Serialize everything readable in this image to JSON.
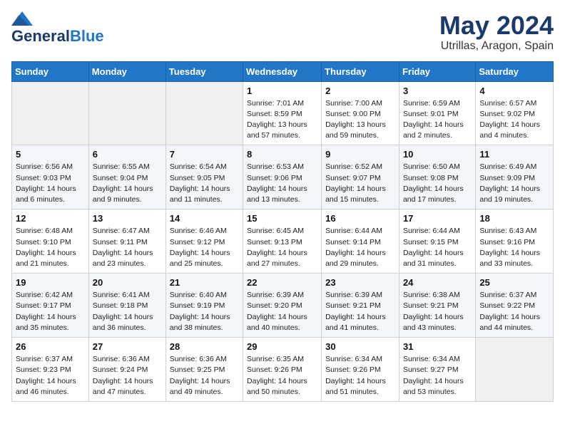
{
  "header": {
    "logo_general": "General",
    "logo_blue": "Blue",
    "month": "May 2024",
    "location": "Utrillas, Aragon, Spain"
  },
  "days_of_week": [
    "Sunday",
    "Monday",
    "Tuesday",
    "Wednesday",
    "Thursday",
    "Friday",
    "Saturday"
  ],
  "weeks": [
    [
      {
        "day": "",
        "sunrise": "",
        "sunset": "",
        "daylight": ""
      },
      {
        "day": "",
        "sunrise": "",
        "sunset": "",
        "daylight": ""
      },
      {
        "day": "",
        "sunrise": "",
        "sunset": "",
        "daylight": ""
      },
      {
        "day": "1",
        "sunrise": "Sunrise: 7:01 AM",
        "sunset": "Sunset: 8:59 PM",
        "daylight": "Daylight: 13 hours and 57 minutes."
      },
      {
        "day": "2",
        "sunrise": "Sunrise: 7:00 AM",
        "sunset": "Sunset: 9:00 PM",
        "daylight": "Daylight: 13 hours and 59 minutes."
      },
      {
        "day": "3",
        "sunrise": "Sunrise: 6:59 AM",
        "sunset": "Sunset: 9:01 PM",
        "daylight": "Daylight: 14 hours and 2 minutes."
      },
      {
        "day": "4",
        "sunrise": "Sunrise: 6:57 AM",
        "sunset": "Sunset: 9:02 PM",
        "daylight": "Daylight: 14 hours and 4 minutes."
      }
    ],
    [
      {
        "day": "5",
        "sunrise": "Sunrise: 6:56 AM",
        "sunset": "Sunset: 9:03 PM",
        "daylight": "Daylight: 14 hours and 6 minutes."
      },
      {
        "day": "6",
        "sunrise": "Sunrise: 6:55 AM",
        "sunset": "Sunset: 9:04 PM",
        "daylight": "Daylight: 14 hours and 9 minutes."
      },
      {
        "day": "7",
        "sunrise": "Sunrise: 6:54 AM",
        "sunset": "Sunset: 9:05 PM",
        "daylight": "Daylight: 14 hours and 11 minutes."
      },
      {
        "day": "8",
        "sunrise": "Sunrise: 6:53 AM",
        "sunset": "Sunset: 9:06 PM",
        "daylight": "Daylight: 14 hours and 13 minutes."
      },
      {
        "day": "9",
        "sunrise": "Sunrise: 6:52 AM",
        "sunset": "Sunset: 9:07 PM",
        "daylight": "Daylight: 14 hours and 15 minutes."
      },
      {
        "day": "10",
        "sunrise": "Sunrise: 6:50 AM",
        "sunset": "Sunset: 9:08 PM",
        "daylight": "Daylight: 14 hours and 17 minutes."
      },
      {
        "day": "11",
        "sunrise": "Sunrise: 6:49 AM",
        "sunset": "Sunset: 9:09 PM",
        "daylight": "Daylight: 14 hours and 19 minutes."
      }
    ],
    [
      {
        "day": "12",
        "sunrise": "Sunrise: 6:48 AM",
        "sunset": "Sunset: 9:10 PM",
        "daylight": "Daylight: 14 hours and 21 minutes."
      },
      {
        "day": "13",
        "sunrise": "Sunrise: 6:47 AM",
        "sunset": "Sunset: 9:11 PM",
        "daylight": "Daylight: 14 hours and 23 minutes."
      },
      {
        "day": "14",
        "sunrise": "Sunrise: 6:46 AM",
        "sunset": "Sunset: 9:12 PM",
        "daylight": "Daylight: 14 hours and 25 minutes."
      },
      {
        "day": "15",
        "sunrise": "Sunrise: 6:45 AM",
        "sunset": "Sunset: 9:13 PM",
        "daylight": "Daylight: 14 hours and 27 minutes."
      },
      {
        "day": "16",
        "sunrise": "Sunrise: 6:44 AM",
        "sunset": "Sunset: 9:14 PM",
        "daylight": "Daylight: 14 hours and 29 minutes."
      },
      {
        "day": "17",
        "sunrise": "Sunrise: 6:44 AM",
        "sunset": "Sunset: 9:15 PM",
        "daylight": "Daylight: 14 hours and 31 minutes."
      },
      {
        "day": "18",
        "sunrise": "Sunrise: 6:43 AM",
        "sunset": "Sunset: 9:16 PM",
        "daylight": "Daylight: 14 hours and 33 minutes."
      }
    ],
    [
      {
        "day": "19",
        "sunrise": "Sunrise: 6:42 AM",
        "sunset": "Sunset: 9:17 PM",
        "daylight": "Daylight: 14 hours and 35 minutes."
      },
      {
        "day": "20",
        "sunrise": "Sunrise: 6:41 AM",
        "sunset": "Sunset: 9:18 PM",
        "daylight": "Daylight: 14 hours and 36 minutes."
      },
      {
        "day": "21",
        "sunrise": "Sunrise: 6:40 AM",
        "sunset": "Sunset: 9:19 PM",
        "daylight": "Daylight: 14 hours and 38 minutes."
      },
      {
        "day": "22",
        "sunrise": "Sunrise: 6:39 AM",
        "sunset": "Sunset: 9:20 PM",
        "daylight": "Daylight: 14 hours and 40 minutes."
      },
      {
        "day": "23",
        "sunrise": "Sunrise: 6:39 AM",
        "sunset": "Sunset: 9:21 PM",
        "daylight": "Daylight: 14 hours and 41 minutes."
      },
      {
        "day": "24",
        "sunrise": "Sunrise: 6:38 AM",
        "sunset": "Sunset: 9:21 PM",
        "daylight": "Daylight: 14 hours and 43 minutes."
      },
      {
        "day": "25",
        "sunrise": "Sunrise: 6:37 AM",
        "sunset": "Sunset: 9:22 PM",
        "daylight": "Daylight: 14 hours and 44 minutes."
      }
    ],
    [
      {
        "day": "26",
        "sunrise": "Sunrise: 6:37 AM",
        "sunset": "Sunset: 9:23 PM",
        "daylight": "Daylight: 14 hours and 46 minutes."
      },
      {
        "day": "27",
        "sunrise": "Sunrise: 6:36 AM",
        "sunset": "Sunset: 9:24 PM",
        "daylight": "Daylight: 14 hours and 47 minutes."
      },
      {
        "day": "28",
        "sunrise": "Sunrise: 6:36 AM",
        "sunset": "Sunset: 9:25 PM",
        "daylight": "Daylight: 14 hours and 49 minutes."
      },
      {
        "day": "29",
        "sunrise": "Sunrise: 6:35 AM",
        "sunset": "Sunset: 9:26 PM",
        "daylight": "Daylight: 14 hours and 50 minutes."
      },
      {
        "day": "30",
        "sunrise": "Sunrise: 6:34 AM",
        "sunset": "Sunset: 9:26 PM",
        "daylight": "Daylight: 14 hours and 51 minutes."
      },
      {
        "day": "31",
        "sunrise": "Sunrise: 6:34 AM",
        "sunset": "Sunset: 9:27 PM",
        "daylight": "Daylight: 14 hours and 53 minutes."
      },
      {
        "day": "",
        "sunrise": "",
        "sunset": "",
        "daylight": ""
      }
    ]
  ]
}
